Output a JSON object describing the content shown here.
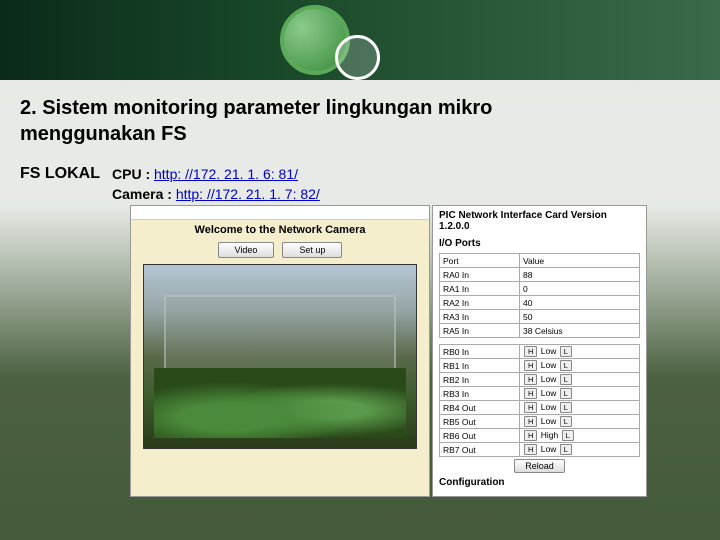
{
  "slide": {
    "title_line1": "2. Sistem monitoring parameter lingkungan mikro",
    "title_line2": "menggunakan FS",
    "fs_label": "FS LOKAL",
    "cpu_label": "CPU : ",
    "cpu_url": "http: //172. 21. 1. 6: 81/",
    "camera_label": "Camera : ",
    "camera_url": "http: //172. 21. 1. 7: 82/"
  },
  "camera_panel": {
    "welcome": "Welcome to the Network Camera",
    "video_btn": "Video",
    "setup_btn": "Set up"
  },
  "pic_panel": {
    "title": "PIC Network Interface Card Version 1.2.0.0",
    "io_header": "I/O Ports",
    "col_port": "Port",
    "col_value": "Value",
    "ra_rows": [
      {
        "port": "RA0 In",
        "value": "88"
      },
      {
        "port": "RA1 In",
        "value": "0"
      },
      {
        "port": "RA2 In",
        "value": "40"
      },
      {
        "port": "RA3 In",
        "value": "50"
      },
      {
        "port": "RA5 In",
        "value": "38 Celsius"
      }
    ],
    "rb_rows": [
      {
        "port": "RB0 In",
        "state": "Low"
      },
      {
        "port": "RB1 In",
        "state": "Low"
      },
      {
        "port": "RB2 In",
        "state": "Low"
      },
      {
        "port": "RB3 In",
        "state": "Low"
      },
      {
        "port": "RB4 Out",
        "state": "Low"
      },
      {
        "port": "RB5 Out",
        "state": "Low"
      },
      {
        "port": "RB6 Out",
        "state": "High"
      },
      {
        "port": "RB7 Out",
        "state": "Low"
      }
    ],
    "btn_h": "H",
    "btn_l": "L",
    "reload": "Reload",
    "config_header": "Configuration"
  }
}
